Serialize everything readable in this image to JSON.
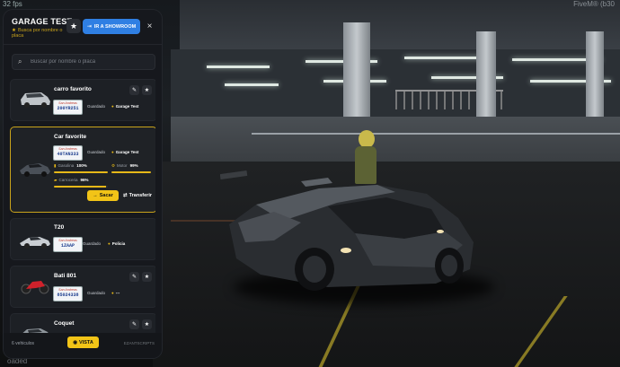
{
  "hud": {
    "top_left": "32 fps",
    "top_right": "FiveM® (b30",
    "bottom_left": "oaded"
  },
  "garage": {
    "title": "GARAGE TEST",
    "subtitle": "Busca por nombre o placa",
    "showroom_label": "IR A SHOWROOM",
    "search_placeholder": "Buscar por nombre o placa",
    "vehicles": [
      {
        "name": "carro favorito",
        "plate_state": "San Andreas",
        "plate": "200YR251",
        "status": "Guardado",
        "location": "Garage Test"
      },
      {
        "name": "Car favorite",
        "plate_state": "San Andreas",
        "plate": "40TAN333",
        "status": "Guardado",
        "location": "Garage Test",
        "stats": {
          "fuel_label": "Gasolina",
          "fuel_value": "100%",
          "fuel_level": 1.0,
          "engine_label": "Motor",
          "engine_value": "99%",
          "engine_level": 0.99,
          "body_label": "Carroceria",
          "body_value": "96%",
          "body_level": 0.96
        },
        "take_out_label": "Sacar",
        "transfer_label": "Transferir"
      },
      {
        "name": "T20",
        "plate_state": "San Andreas",
        "plate": "1ZAAP",
        "status": "Guardado",
        "location": "Policia"
      },
      {
        "name": "Bati 801",
        "plate_state": "San Andreas",
        "plate": "85024338",
        "status": "Guardado",
        "location": "---"
      },
      {
        "name": "Coquet",
        "plate_state": "San Andreas",
        "plate": "",
        "status": "",
        "location": ""
      }
    ],
    "vehicle_count": "6 vehiculos",
    "view_label": "VISTA",
    "credit": "EZANTSCRIPTS"
  },
  "colors": {
    "accent": "#f2c417",
    "primary": "#2f7fe3",
    "panel_bg": "#16181d"
  }
}
